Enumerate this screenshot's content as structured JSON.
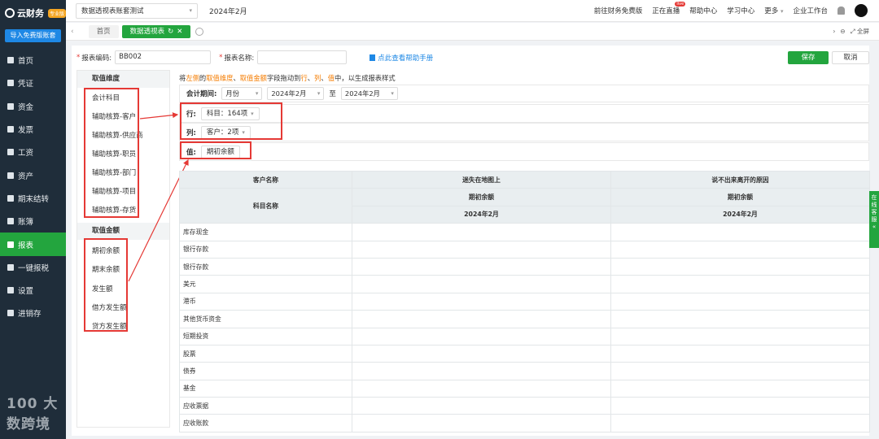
{
  "app": {
    "logo_text": "云财务",
    "logo_badge": "专业版",
    "import_button": "导入免费版账套",
    "watermark": "100 大数跨境"
  },
  "sidebar": {
    "items": [
      {
        "label": "首页",
        "icon": "home-icon",
        "active": false
      },
      {
        "label": "凭证",
        "icon": "voucher-icon",
        "active": false
      },
      {
        "label": "资金",
        "icon": "funds-icon",
        "active": false
      },
      {
        "label": "发票",
        "icon": "invoice-icon",
        "active": false
      },
      {
        "label": "工资",
        "icon": "salary-icon",
        "active": false
      },
      {
        "label": "资产",
        "icon": "asset-icon",
        "active": false
      },
      {
        "label": "期末结转",
        "icon": "closing-icon",
        "active": false
      },
      {
        "label": "账簿",
        "icon": "ledger-icon",
        "active": false
      },
      {
        "label": "报表",
        "icon": "report-icon",
        "active": true
      },
      {
        "label": "一键报税",
        "icon": "tax-icon",
        "active": false
      },
      {
        "label": "设置",
        "icon": "settings-icon",
        "active": false
      },
      {
        "label": "进销存",
        "icon": "inventory-icon",
        "active": false
      }
    ]
  },
  "topbar": {
    "account_name": "数据透视表账套测试",
    "period": "2024年2月",
    "links": [
      "前往财务免费版",
      "正在直播",
      "帮助中心",
      "学习中心",
      "更多",
      "企业工作台"
    ],
    "live_badge": "live"
  },
  "tabs": {
    "home": "首页",
    "active": "数据透视表",
    "fullscreen": "全屏"
  },
  "form": {
    "code_label": "报表编码:",
    "code_value": "BB002",
    "name_label": "报表名称:",
    "name_value": "",
    "help_link": "点此查看帮助手册",
    "save": "保存",
    "cancel": "取消"
  },
  "fields": {
    "dimension_header": "取值维度",
    "dimensions": [
      "会计科目",
      "辅助核算-客户",
      "辅助核算-供应商",
      "辅助核算-职员",
      "辅助核算-部门",
      "辅助核算-项目",
      "辅助核算-存货"
    ],
    "measure_header": "取值金额",
    "measures": [
      "期初余额",
      "期末余额",
      "发生额",
      "借方发生额",
      "贷方发生额"
    ]
  },
  "config": {
    "hint_parts": [
      "将",
      "左侧",
      "的",
      "取值维度",
      "、",
      "取值金额",
      "字段拖动到",
      "行",
      "、",
      "列",
      "、",
      "值",
      "中，以生成报表样式"
    ],
    "period_label": "会计期间:",
    "period_type": "月份",
    "period_from": "2024年2月",
    "period_to_label": "至",
    "period_to": "2024年2月",
    "row_label": "行:",
    "row_chip": "科目：164项",
    "col_label": "列:",
    "col_chip": "客户：2项",
    "value_label": "值:",
    "value_chip": "期初余额"
  },
  "table": {
    "corner_top": "客户名称",
    "corner_bottom": "科目名称",
    "customers": [
      "迷失在地图上",
      "说不出来离开的原因"
    ],
    "measure": "期初余额",
    "period": "2024年2月",
    "rows": [
      "库存现金",
      "银行存款",
      "银行存款",
      "美元",
      "港币",
      "其他货币资金",
      "短期投资",
      "股票",
      "债券",
      "基金",
      "应收票据",
      "应收账款"
    ]
  },
  "service": {
    "label": "在线客服"
  }
}
